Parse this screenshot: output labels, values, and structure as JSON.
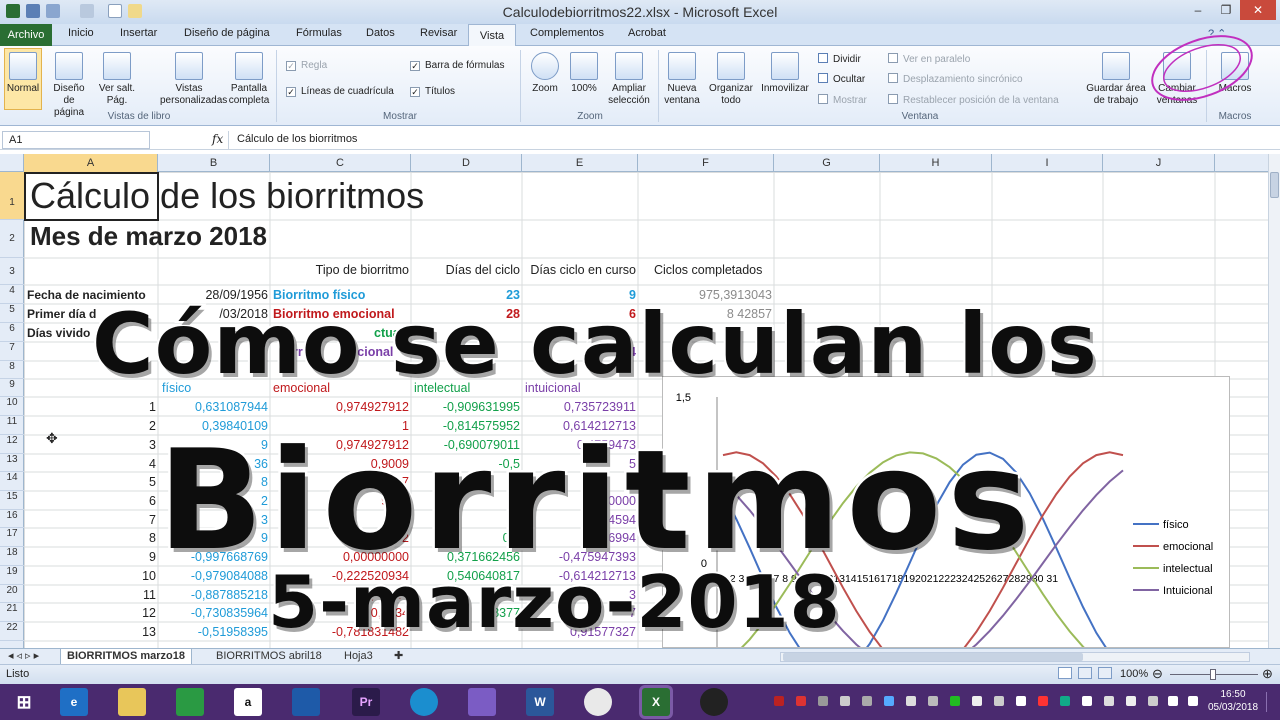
{
  "window": {
    "title": "Calculodebiorritmos22.xlsx - Microsoft Excel"
  },
  "tabs": [
    "Inicio",
    "Insertar",
    "Diseño de página",
    "Fórmulas",
    "Datos",
    "Revisar",
    "Vista",
    "Complementos",
    "Acrobat"
  ],
  "file_tab": "Archivo",
  "ribbon": {
    "normal": "Normal",
    "page_layout": "Diseño de página",
    "page_break": "Ver salt. Pág.",
    "custom_views": "Vistas personalizadas",
    "full_screen": "Pantalla completa",
    "group_views": "Vistas de libro",
    "regla": "Regla",
    "lineas": "Líneas de cuadrícula",
    "barra": "Barra de fórmulas",
    "titulos": "Títulos",
    "group_show": "Mostrar",
    "zoom": "Zoom",
    "zoom100": "100%",
    "zoom_sel": "Ampliar selección",
    "group_zoom": "Zoom",
    "new_window": "Nueva ventana",
    "arrange": "Organizar todo",
    "freeze": "Inmovilizar",
    "split": "Dividir",
    "hide": "Ocultar",
    "unhide": "Mostrar",
    "side": "Ver en paralelo",
    "sync": "Desplazamiento sincrónico",
    "reset": "Restablecer posición de la ventana",
    "save_ws": "Guardar área de trabajo",
    "switch": "Cambiar ventanas",
    "group_window": "Ventana",
    "macros": "Macros",
    "group_macros": "Macros"
  },
  "formula_bar": {
    "name_box": "A1",
    "fx": "fx",
    "content": "Cálculo de los biorritmos"
  },
  "columns": [
    "A",
    "B",
    "C",
    "D",
    "E",
    "F",
    "G",
    "H",
    "I",
    "J"
  ],
  "rows": [
    "1",
    "2",
    "3",
    "4",
    "5",
    "6",
    "7",
    "8",
    "9",
    "10",
    "11",
    "12",
    "13",
    "14",
    "15",
    "16",
    "17",
    "18",
    "19",
    "20",
    "21",
    "22"
  ],
  "sheet": {
    "title": "Cálculo de los biorritmos",
    "subtitle": "Mes de marzo 2018",
    "h_tipo": "Tipo de biorritmo",
    "h_dias": "Días del ciclo",
    "h_curso": "Días ciclo en curso",
    "h_ciclos": "Ciclos completados",
    "r4a": "Fecha de nacimiento",
    "r4b": "28/09/1956",
    "r4c": "Biorritmo físico",
    "r4d": "23",
    "r4e": "9",
    "r4f": "975,3913043",
    "r5a": "Primer día d",
    "r5b": "/03/2018",
    "r5c": "Biorritmo emocional",
    "r5d": "28",
    "r5e": "6",
    "r5f": "8 42857",
    "r6a": "Días vivido",
    "r6c": "ctual",
    "r6f": "6",
    "r7c1": "err",
    "r7c2": "tuicional",
    "r7e": "14",
    "r7f": "11",
    "r9b": "físico",
    "r9c": "emocional",
    "r9d": "intelectual",
    "r9e": "intuicional",
    "data": [
      [
        "1",
        "0,631087944",
        "0,974927912",
        "-0,909631995",
        "0,735723911"
      ],
      [
        "2",
        "0,39840109",
        "1",
        "-0,814575952",
        "0,614212713"
      ],
      [
        "3",
        "9",
        "0,974927912",
        "-0,690079011",
        "0,4759473"
      ],
      [
        "4",
        "36",
        "0,9009",
        "-0,5",
        "5"
      ],
      [
        "5",
        "8",
        "0,7",
        "3",
        "1"
      ],
      [
        "6",
        "2",
        "9802",
        "0",
        "00000"
      ],
      [
        "7",
        "3",
        "2",
        "00",
        "64594"
      ],
      [
        "8",
        "9",
        "0,222",
        "0,1",
        "6994"
      ],
      [
        "9",
        "-0,997668769",
        "0,00000000",
        "0,371662456",
        "-0,475947393"
      ],
      [
        "10",
        "-0,979084088",
        "-0,222520934",
        "0,540640817",
        "-0,614212713"
      ],
      [
        "11",
        "-0,887885218",
        "-0,43388",
        "",
        "3"
      ],
      [
        "12",
        "-0,730835964",
        "-0,6234",
        "8377",
        "7"
      ],
      [
        "13",
        "-0,51958395",
        "-0,781831482",
        "",
        "0,91577327"
      ]
    ]
  },
  "chart": {
    "ymax": "1,5",
    "yzero": "0",
    "x_labels": "1 2 3 4 5 6 7 8 9 101112131415161718192021222324252627282930 31"
  },
  "chart_data": {
    "type": "line",
    "categories": [
      "1",
      "2",
      "3",
      "4",
      "5",
      "6",
      "7",
      "8",
      "9",
      "10",
      "11",
      "12",
      "13",
      "14",
      "15",
      "16",
      "17",
      "18",
      "19",
      "20",
      "21",
      "22",
      "23",
      "24",
      "25",
      "26",
      "27",
      "28",
      "29",
      "30",
      "31"
    ],
    "ylim": [
      -1.5,
      1.5
    ],
    "series": [
      {
        "name": "físico",
        "color": "#4472c4",
        "values": [
          0.631,
          0.398,
          0.136,
          -0.136,
          -0.398,
          -0.631,
          -0.817,
          -0.942,
          -0.998,
          -0.979,
          -0.888,
          -0.731,
          -0.52,
          -0.27,
          0.0,
          0.27,
          0.52,
          0.731,
          0.888,
          0.979,
          0.998,
          0.942,
          0.817,
          0.631,
          0.398,
          0.136,
          -0.136,
          -0.398,
          -0.631,
          -0.817,
          -0.942
        ]
      },
      {
        "name": "emocional",
        "color": "#c0504d",
        "values": [
          0.975,
          1.0,
          0.975,
          0.901,
          0.782,
          0.623,
          0.434,
          0.223,
          0.0,
          -0.223,
          -0.434,
          -0.623,
          -0.782,
          -0.901,
          -0.975,
          -1.0,
          -0.975,
          -0.901,
          -0.782,
          -0.623,
          -0.434,
          -0.223,
          0.0,
          0.223,
          0.434,
          0.623,
          0.782,
          0.901,
          0.975,
          1.0,
          0.975
        ]
      },
      {
        "name": "intelectual",
        "color": "#9bbb59",
        "values": [
          -0.91,
          -0.815,
          -0.69,
          -0.541,
          -0.372,
          -0.19,
          0.0,
          0.19,
          0.372,
          0.541,
          0.69,
          0.815,
          0.91,
          0.972,
          0.999,
          0.99,
          0.945,
          0.866,
          0.756,
          0.618,
          0.458,
          0.282,
          0.095,
          -0.095,
          -0.282,
          -0.458,
          -0.618,
          -0.756,
          -0.866,
          -0.945,
          -0.99
        ]
      },
      {
        "name": "Intuicional",
        "color": "#8064a2",
        "values": [
          0.736,
          0.614,
          0.476,
          0.325,
          0.165,
          0.0,
          -0.165,
          -0.325,
          -0.476,
          -0.614,
          -0.736,
          -0.837,
          -0.916,
          -0.97,
          -0.997,
          -0.997,
          -0.97,
          -0.916,
          -0.837,
          -0.736,
          -0.614,
          -0.476,
          -0.325,
          -0.165,
          0.0,
          0.165,
          0.325,
          0.476,
          0.614,
          0.736,
          0.837
        ]
      }
    ]
  },
  "sheet_tabs": [
    "BIORRITMOS marzo18",
    "BIORRITMOS abril18",
    "Hoja3"
  ],
  "status": {
    "ready": "Listo",
    "zoom": "100%"
  },
  "clock": {
    "time": "16:50",
    "date": "05/03/2018"
  },
  "overlay": {
    "line1": "Cómo se calculan los",
    "line2": "Biorritmos",
    "line3": "5-marzo-2018"
  },
  "colors": {
    "excel_green": "#2a6e33",
    "taskbar": "#4a2a6f",
    "physical": "#1f9bd8",
    "emotional": "#c0191c",
    "intellectual": "#12a04a"
  }
}
